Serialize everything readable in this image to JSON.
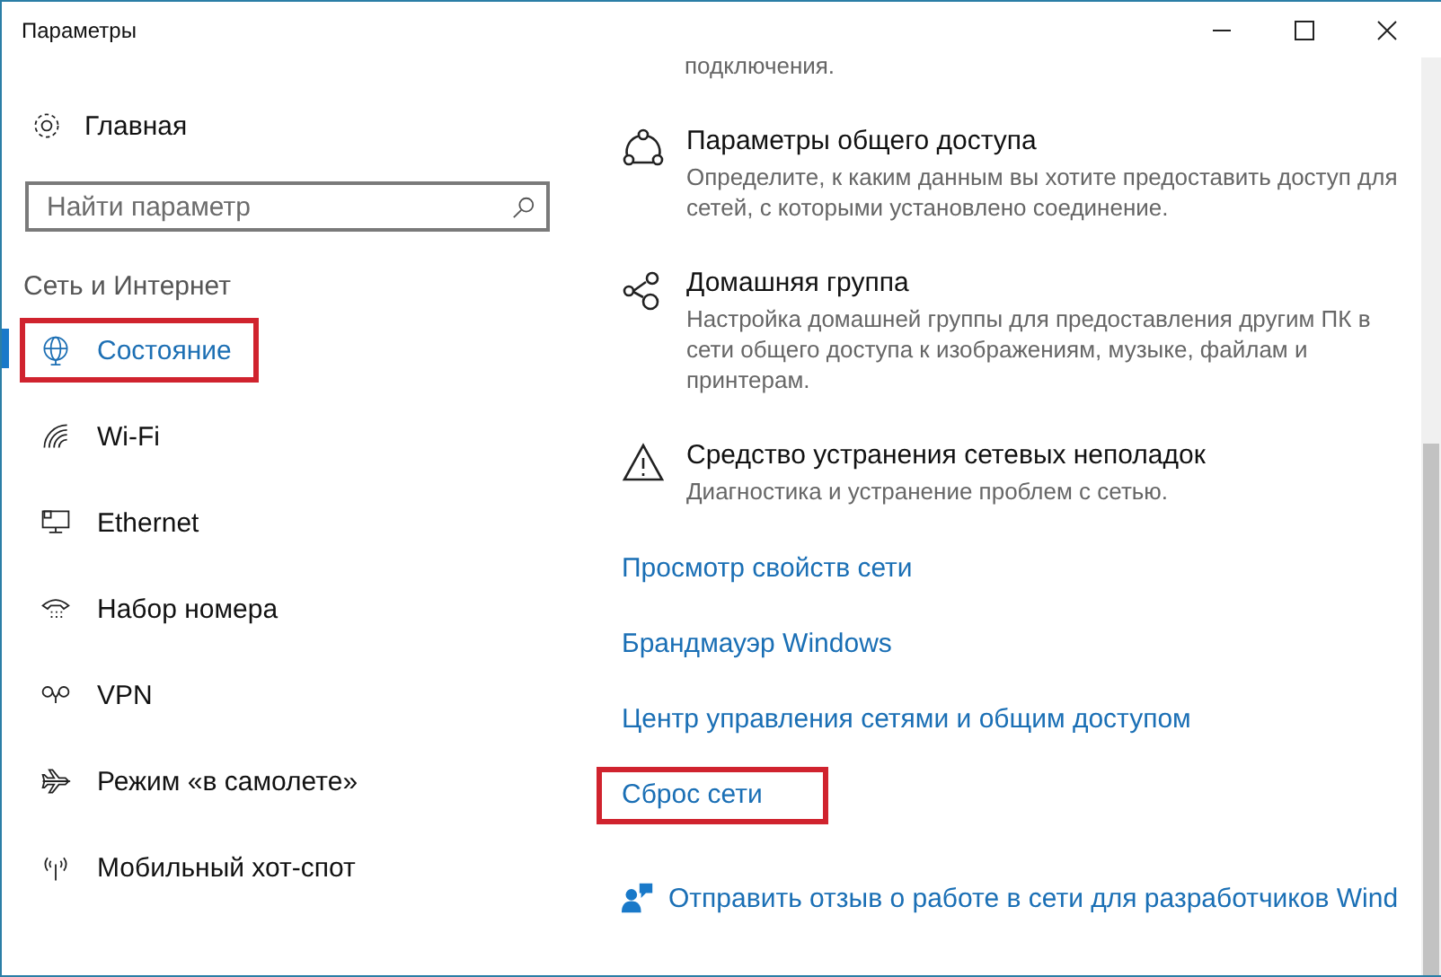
{
  "window": {
    "title": "Параметры"
  },
  "sidebar": {
    "home": "Главная",
    "search": {
      "placeholder": "Найти параметр"
    },
    "category": "Сеть и Интернет",
    "items": [
      {
        "kind": "status",
        "label": "Состояние",
        "selected": true,
        "highlighted": true
      },
      {
        "kind": "wifi",
        "label": "Wi-Fi",
        "selected": false,
        "highlighted": false
      },
      {
        "kind": "ethernet",
        "label": "Ethernet",
        "selected": false,
        "highlighted": false
      },
      {
        "kind": "dialup",
        "label": "Набор номера",
        "selected": false,
        "highlighted": false
      },
      {
        "kind": "vpn",
        "label": "VPN",
        "selected": false,
        "highlighted": false
      },
      {
        "kind": "airplane",
        "label": "Режим «в самолете»",
        "selected": false,
        "highlighted": false
      },
      {
        "kind": "hotspot",
        "label": "Мобильный хот-спот",
        "selected": false,
        "highlighted": false
      }
    ]
  },
  "content": {
    "cut_text": "подключения.",
    "sections": [
      {
        "kind": "sharing",
        "title": "Параметры общего доступа",
        "description": "Определите, к каким данным вы хотите предоставить доступ для сетей, с которыми установлено соединение."
      },
      {
        "kind": "homegroup",
        "title": "Домашняя группа",
        "description": "Настройка домашней группы для предоставления другим ПК в сети общего доступа к изображениям, музыке, файлам и принтерам."
      },
      {
        "kind": "troubleshoot",
        "title": "Средство устранения сетевых неполадок",
        "description": "Диагностика и устранение проблем с сетью."
      }
    ],
    "links": [
      {
        "label": "Просмотр свойств сети",
        "highlighted": false
      },
      {
        "label": "Брандмауэр Windows",
        "highlighted": false
      },
      {
        "label": "Центр управления сетями и общим доступом",
        "highlighted": false
      },
      {
        "label": "Сброс сети",
        "highlighted": true
      }
    ],
    "feedback": "Отправить отзыв о работе в сети для разработчиков Wind"
  }
}
